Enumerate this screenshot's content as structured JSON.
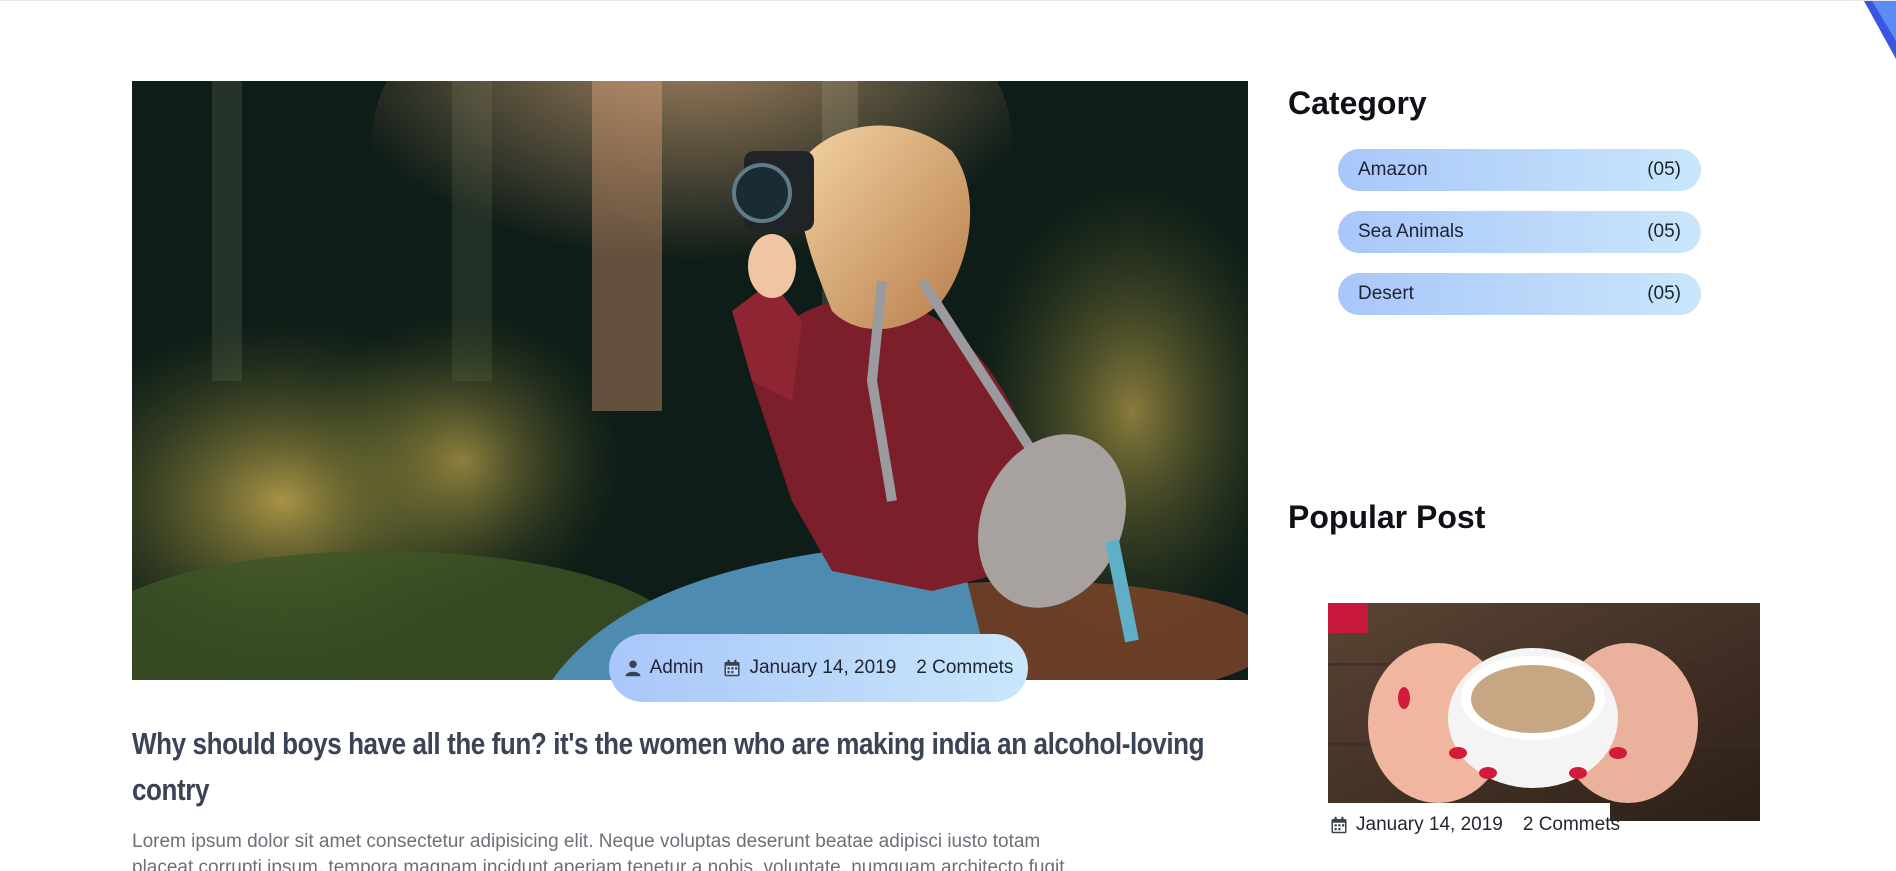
{
  "post": {
    "meta": {
      "author": "Admin",
      "date": "January 14, 2019",
      "comments": "2 Commets"
    },
    "title": "Why should boys have all the fun? it's the women who are making india an alcohol-loving contry",
    "excerpt_line1": "Lorem ipsum dolor sit amet consectetur adipisicing elit. Neque voluptas deserunt beatae adipisci iusto totam",
    "excerpt_line2": "placeat corrupti ipsum, tempora magnam incidunt aperiam tenetur a nobis, voluptate, numquam architecto fugit."
  },
  "sidebar": {
    "category_heading": "Category",
    "categories": [
      {
        "name": "Amazon",
        "count": "(05)"
      },
      {
        "name": "Sea Animals",
        "count": "(05)"
      },
      {
        "name": "Desert",
        "count": "(05)"
      }
    ],
    "popular_heading": "Popular Post",
    "popular_post": {
      "date": "January 14, 2019",
      "comments": "2 Commets"
    }
  },
  "icons": {
    "author": "user-icon",
    "date": "calendar-icon"
  },
  "colors": {
    "pill_gradient_start": "#a9c6fa",
    "pill_gradient_end": "#c9e6fb",
    "title_color": "#3b4356",
    "corner_accent": "#3b55e0"
  }
}
